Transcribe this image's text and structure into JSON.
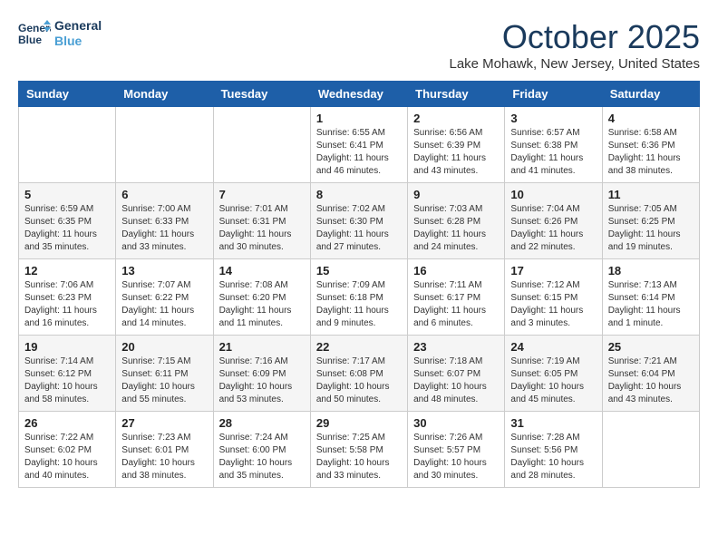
{
  "header": {
    "logo_line1": "General",
    "logo_line2": "Blue",
    "month": "October 2025",
    "location": "Lake Mohawk, New Jersey, United States"
  },
  "days_of_week": [
    "Sunday",
    "Monday",
    "Tuesday",
    "Wednesday",
    "Thursday",
    "Friday",
    "Saturday"
  ],
  "weeks": [
    [
      {
        "day": "",
        "content": ""
      },
      {
        "day": "",
        "content": ""
      },
      {
        "day": "",
        "content": ""
      },
      {
        "day": "1",
        "content": "Sunrise: 6:55 AM\nSunset: 6:41 PM\nDaylight: 11 hours\nand 46 minutes."
      },
      {
        "day": "2",
        "content": "Sunrise: 6:56 AM\nSunset: 6:39 PM\nDaylight: 11 hours\nand 43 minutes."
      },
      {
        "day": "3",
        "content": "Sunrise: 6:57 AM\nSunset: 6:38 PM\nDaylight: 11 hours\nand 41 minutes."
      },
      {
        "day": "4",
        "content": "Sunrise: 6:58 AM\nSunset: 6:36 PM\nDaylight: 11 hours\nand 38 minutes."
      }
    ],
    [
      {
        "day": "5",
        "content": "Sunrise: 6:59 AM\nSunset: 6:35 PM\nDaylight: 11 hours\nand 35 minutes."
      },
      {
        "day": "6",
        "content": "Sunrise: 7:00 AM\nSunset: 6:33 PM\nDaylight: 11 hours\nand 33 minutes."
      },
      {
        "day": "7",
        "content": "Sunrise: 7:01 AM\nSunset: 6:31 PM\nDaylight: 11 hours\nand 30 minutes."
      },
      {
        "day": "8",
        "content": "Sunrise: 7:02 AM\nSunset: 6:30 PM\nDaylight: 11 hours\nand 27 minutes."
      },
      {
        "day": "9",
        "content": "Sunrise: 7:03 AM\nSunset: 6:28 PM\nDaylight: 11 hours\nand 24 minutes."
      },
      {
        "day": "10",
        "content": "Sunrise: 7:04 AM\nSunset: 6:26 PM\nDaylight: 11 hours\nand 22 minutes."
      },
      {
        "day": "11",
        "content": "Sunrise: 7:05 AM\nSunset: 6:25 PM\nDaylight: 11 hours\nand 19 minutes."
      }
    ],
    [
      {
        "day": "12",
        "content": "Sunrise: 7:06 AM\nSunset: 6:23 PM\nDaylight: 11 hours\nand 16 minutes."
      },
      {
        "day": "13",
        "content": "Sunrise: 7:07 AM\nSunset: 6:22 PM\nDaylight: 11 hours\nand 14 minutes."
      },
      {
        "day": "14",
        "content": "Sunrise: 7:08 AM\nSunset: 6:20 PM\nDaylight: 11 hours\nand 11 minutes."
      },
      {
        "day": "15",
        "content": "Sunrise: 7:09 AM\nSunset: 6:18 PM\nDaylight: 11 hours\nand 9 minutes."
      },
      {
        "day": "16",
        "content": "Sunrise: 7:11 AM\nSunset: 6:17 PM\nDaylight: 11 hours\nand 6 minutes."
      },
      {
        "day": "17",
        "content": "Sunrise: 7:12 AM\nSunset: 6:15 PM\nDaylight: 11 hours\nand 3 minutes."
      },
      {
        "day": "18",
        "content": "Sunrise: 7:13 AM\nSunset: 6:14 PM\nDaylight: 11 hours\nand 1 minute."
      }
    ],
    [
      {
        "day": "19",
        "content": "Sunrise: 7:14 AM\nSunset: 6:12 PM\nDaylight: 10 hours\nand 58 minutes."
      },
      {
        "day": "20",
        "content": "Sunrise: 7:15 AM\nSunset: 6:11 PM\nDaylight: 10 hours\nand 55 minutes."
      },
      {
        "day": "21",
        "content": "Sunrise: 7:16 AM\nSunset: 6:09 PM\nDaylight: 10 hours\nand 53 minutes."
      },
      {
        "day": "22",
        "content": "Sunrise: 7:17 AM\nSunset: 6:08 PM\nDaylight: 10 hours\nand 50 minutes."
      },
      {
        "day": "23",
        "content": "Sunrise: 7:18 AM\nSunset: 6:07 PM\nDaylight: 10 hours\nand 48 minutes."
      },
      {
        "day": "24",
        "content": "Sunrise: 7:19 AM\nSunset: 6:05 PM\nDaylight: 10 hours\nand 45 minutes."
      },
      {
        "day": "25",
        "content": "Sunrise: 7:21 AM\nSunset: 6:04 PM\nDaylight: 10 hours\nand 43 minutes."
      }
    ],
    [
      {
        "day": "26",
        "content": "Sunrise: 7:22 AM\nSunset: 6:02 PM\nDaylight: 10 hours\nand 40 minutes."
      },
      {
        "day": "27",
        "content": "Sunrise: 7:23 AM\nSunset: 6:01 PM\nDaylight: 10 hours\nand 38 minutes."
      },
      {
        "day": "28",
        "content": "Sunrise: 7:24 AM\nSunset: 6:00 PM\nDaylight: 10 hours\nand 35 minutes."
      },
      {
        "day": "29",
        "content": "Sunrise: 7:25 AM\nSunset: 5:58 PM\nDaylight: 10 hours\nand 33 minutes."
      },
      {
        "day": "30",
        "content": "Sunrise: 7:26 AM\nSunset: 5:57 PM\nDaylight: 10 hours\nand 30 minutes."
      },
      {
        "day": "31",
        "content": "Sunrise: 7:28 AM\nSunset: 5:56 PM\nDaylight: 10 hours\nand 28 minutes."
      },
      {
        "day": "",
        "content": ""
      }
    ]
  ]
}
